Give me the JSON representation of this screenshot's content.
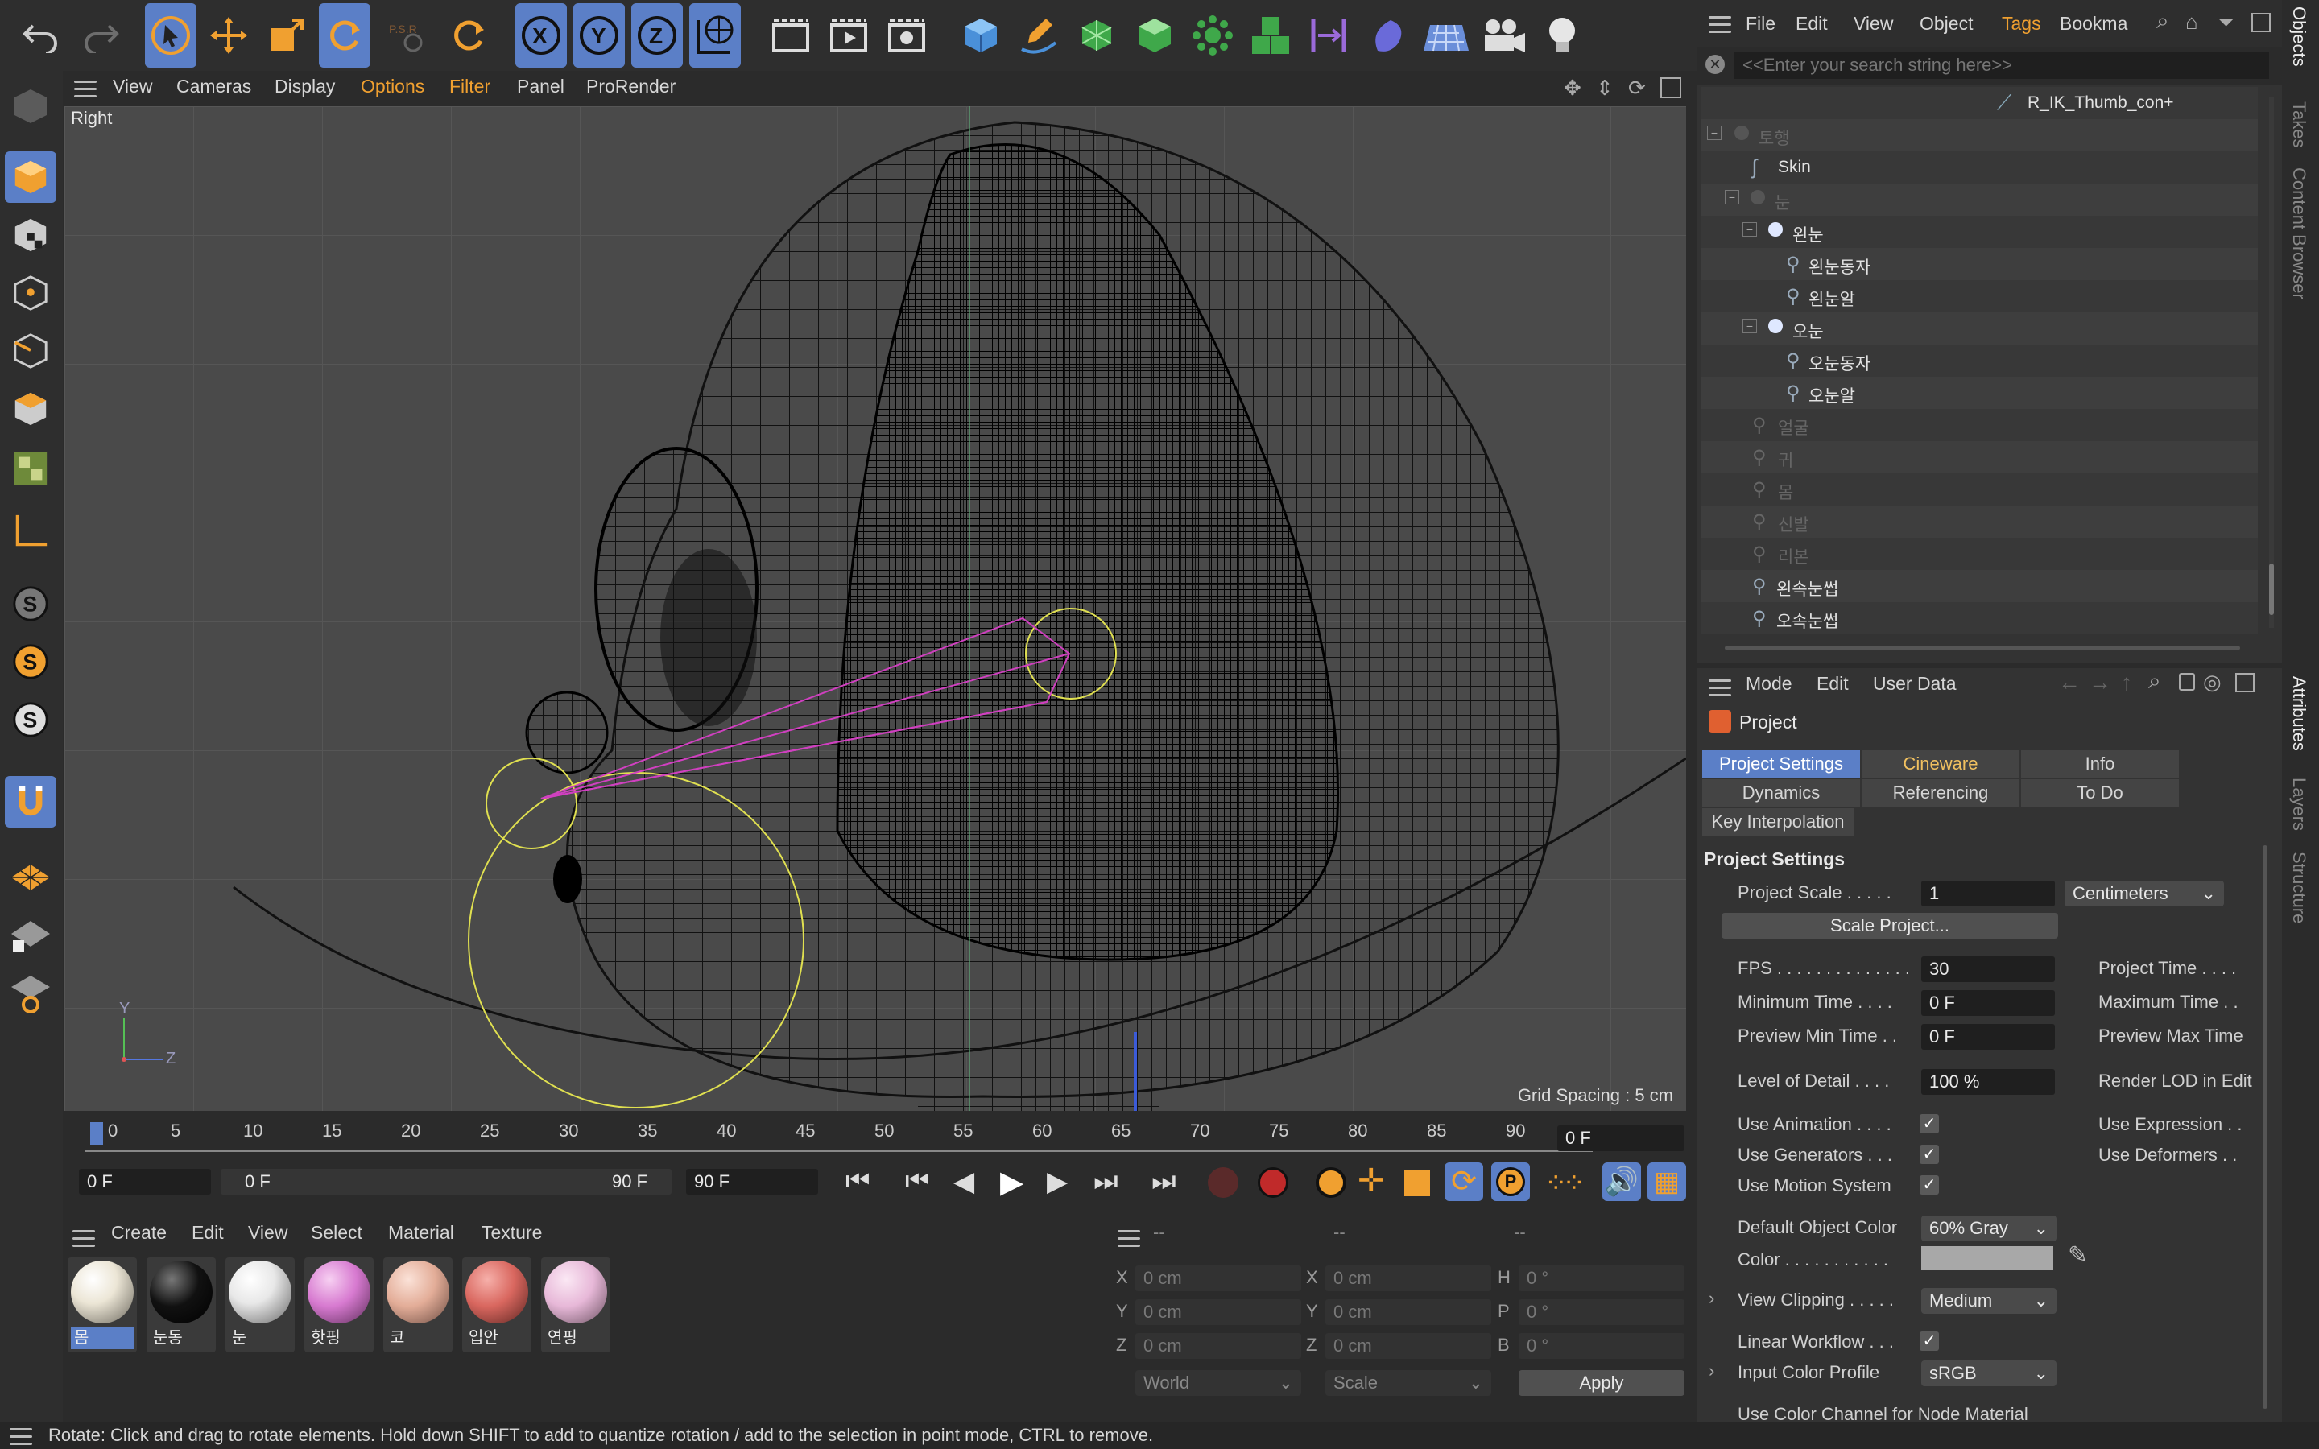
{
  "colors": {
    "accent": "#f0a030",
    "selection": "#5b7fc7",
    "bg": "#2b2b2b",
    "viewport": "#4a4a4a"
  },
  "top_menu": {
    "items": [
      "File",
      "Edit",
      "View",
      "Object",
      "Tags",
      "Bookma"
    ]
  },
  "search": {
    "placeholder": "<<Enter your search string here>>"
  },
  "viewport": {
    "menu": [
      "View",
      "Cameras",
      "Display",
      "Options",
      "Filter",
      "Panel",
      "ProRender"
    ],
    "view_name": "Right",
    "grid_spacing": "Grid Spacing : 5 cm",
    "axis_y": "Y",
    "axis_z": "Z"
  },
  "object_tree": {
    "items": [
      {
        "label": "R_IK_Thumb_con+",
        "dim": false
      },
      {
        "label": "토행",
        "dim": true
      },
      {
        "label": "Skin",
        "dim": false
      },
      {
        "label": "눈",
        "dim": true
      },
      {
        "label": "왼눈",
        "dim": false
      },
      {
        "label": "왼눈동자",
        "dim": false
      },
      {
        "label": "왼눈알",
        "dim": false
      },
      {
        "label": "오눈",
        "dim": false
      },
      {
        "label": "오눈동자",
        "dim": false
      },
      {
        "label": "오눈알",
        "dim": false
      },
      {
        "label": "얼굴",
        "dim": true
      },
      {
        "label": "귀",
        "dim": true
      },
      {
        "label": "몸",
        "dim": true
      },
      {
        "label": "신발",
        "dim": true
      },
      {
        "label": "리본",
        "dim": true
      },
      {
        "label": "왼속눈썹",
        "dim": false
      },
      {
        "label": "오속눈썹",
        "dim": false
      }
    ]
  },
  "right_tabs": {
    "objects": "Objects",
    "takes": "Takes",
    "content": "Content Browser",
    "attributes": "Attributes",
    "layers": "Layers",
    "structure": "Structure"
  },
  "attributes": {
    "menu": [
      "Mode",
      "Edit",
      "User Data"
    ],
    "object_name": "Project",
    "tabs": [
      "Project Settings",
      "Cineware",
      "Info",
      "Dynamics",
      "Referencing",
      "To Do",
      "Key Interpolation"
    ],
    "section": "Project Settings",
    "project_scale_label": "Project Scale . . . . .",
    "project_scale_value": "1",
    "project_scale_unit": "Centimeters",
    "scale_button": "Scale Project...",
    "fps_label": "FPS . . . . . . . . . . . . . .",
    "fps_value": "30",
    "project_time_label": "Project Time . . . .",
    "min_time_label": "Minimum Time . . . .",
    "min_time_value": "0 F",
    "max_time_label": "Maximum Time . .",
    "prev_min_label": "Preview Min Time . .",
    "prev_min_value": "0 F",
    "prev_max_label": "Preview Max Time",
    "lod_label": "Level of Detail . . . .",
    "lod_value": "100 %",
    "render_lod_label": "Render LOD in Edit",
    "use_anim_label": "Use Animation . . . .",
    "use_expr_label": "Use Expression . .",
    "use_gen_label": "Use Generators . . .",
    "use_deform_label": "Use Deformers . .",
    "use_motion_label": "Use Motion System",
    "def_color_label": "Default Object Color",
    "def_color_value": "60% Gray",
    "color_label": "Color . . . . . . . . . . .",
    "view_clip_label": "View Clipping . . . . .",
    "view_clip_value": "Medium",
    "linear_label": "Linear Workflow . . .",
    "input_profile_label": "Input Color Profile",
    "input_profile_value": "sRGB",
    "node_mat_label": "Use Color Channel for Node Material"
  },
  "timeline": {
    "ticks": [
      "0",
      "5",
      "10",
      "15",
      "20",
      "25",
      "30",
      "35",
      "40",
      "45",
      "50",
      "55",
      "60",
      "65",
      "70",
      "75",
      "80",
      "85",
      "90"
    ],
    "current_frame": "0 F",
    "start": "0 F",
    "range_start": "0 F",
    "range_end": "90 F",
    "end": "90 F"
  },
  "materials": {
    "menu": [
      "Create",
      "Edit",
      "View",
      "Select",
      "Material",
      "Texture"
    ],
    "items": [
      {
        "label": "몸",
        "color": "#ece6d6"
      },
      {
        "label": "눈동",
        "color": "#111111"
      },
      {
        "label": "눈",
        "color": "#e8e8e8"
      },
      {
        "label": "핫핑",
        "color": "#d77ad0"
      },
      {
        "label": "코",
        "color": "#e3ad98"
      },
      {
        "label": "입안",
        "color": "#d9675f"
      },
      {
        "label": "연핑",
        "color": "#e7b8d8"
      }
    ]
  },
  "coords": {
    "headers": [
      "--",
      "--",
      "--"
    ],
    "rows": [
      {
        "a": "X",
        "av": "0 cm",
        "b": "X",
        "bv": "0 cm",
        "c": "H",
        "cv": "0 °"
      },
      {
        "a": "Y",
        "av": "0 cm",
        "b": "Y",
        "bv": "0 cm",
        "c": "P",
        "cv": "0 °"
      },
      {
        "a": "Z",
        "av": "0 cm",
        "b": "Z",
        "bv": "0 cm",
        "c": "B",
        "cv": "0 °"
      }
    ],
    "world": "World",
    "scale": "Scale",
    "apply": "Apply"
  },
  "status": "Rotate: Click and drag to rotate elements. Hold down SHIFT to add to quantize rotation / add to the selection in point mode, CTRL to remove."
}
